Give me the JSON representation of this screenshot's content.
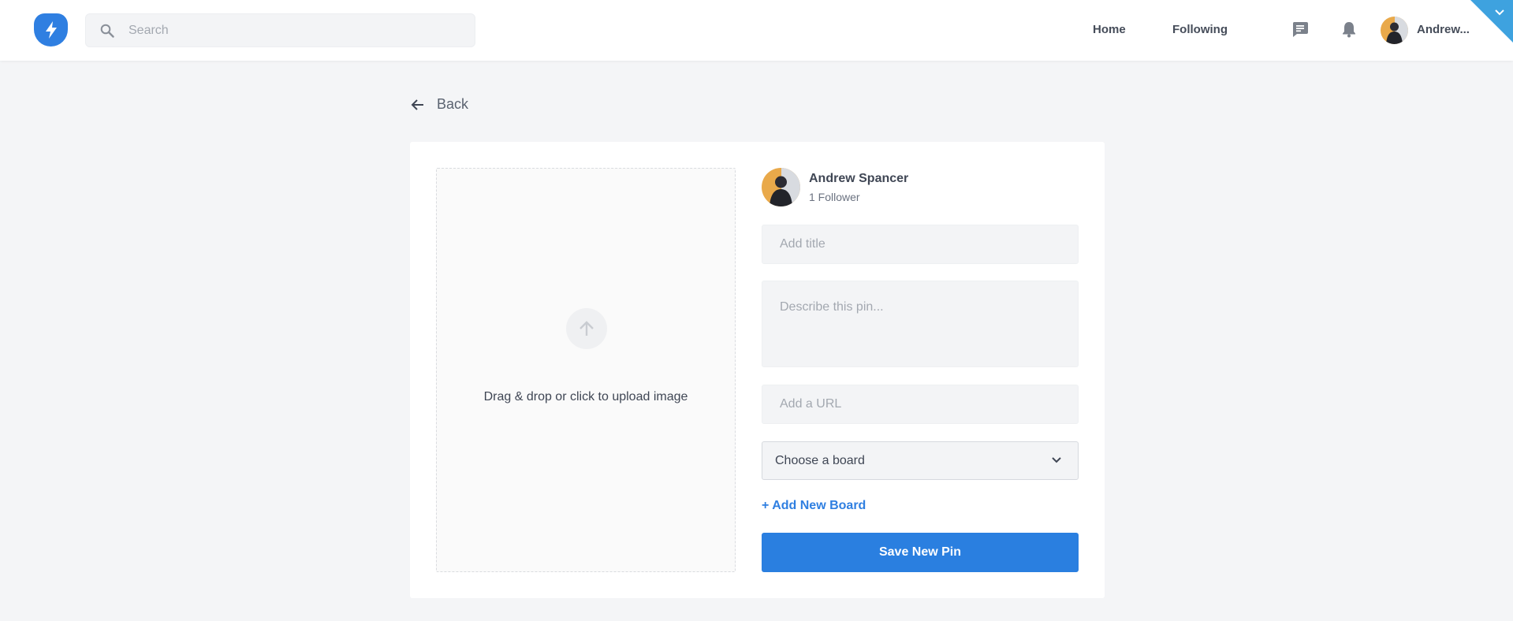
{
  "colors": {
    "accent": "#2a7fe0",
    "page_background": "#f4f5f7",
    "card_background": "#ffffff"
  },
  "header": {
    "logo_icon": "lightning-bolt-icon",
    "search": {
      "placeholder": "Search",
      "value": "",
      "icon": "search-icon"
    },
    "nav": {
      "home_label": "Home",
      "following_label": "Following"
    },
    "icons": [
      "message-icon",
      "bell-icon",
      "chevron-down-icon"
    ],
    "user": {
      "name": "Andrew...",
      "avatar_icon": "avatar"
    }
  },
  "back": {
    "label": "Back",
    "icon": "arrow-left-icon"
  },
  "upload": {
    "label": "Drag & drop or click to upload image",
    "icon": "arrow-up-icon"
  },
  "author": {
    "name": "Andrew Spancer",
    "followers": "1 Follower"
  },
  "form": {
    "title_placeholder": "Add title",
    "description_placeholder": "Describe this pin...",
    "url_placeholder": "Add a URL",
    "board_select": "Choose a board",
    "add_board": "+ Add New Board",
    "save": "Save New Pin"
  }
}
